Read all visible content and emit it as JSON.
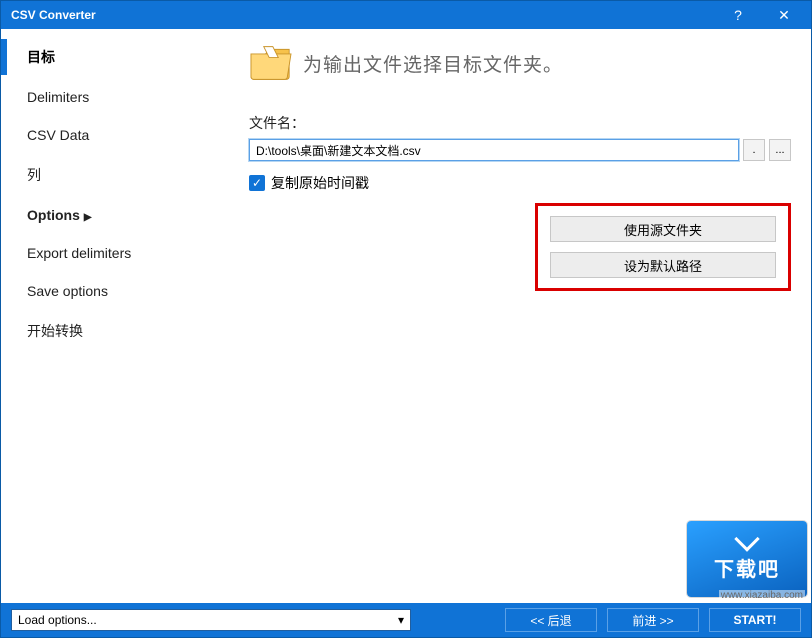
{
  "titlebar": {
    "title": "CSV Converter",
    "help": "?",
    "close": "✕"
  },
  "sidebar": {
    "items": [
      {
        "label": "目标",
        "active": true
      },
      {
        "label": "Delimiters"
      },
      {
        "label": "CSV Data"
      },
      {
        "label": "列"
      },
      {
        "label": "Options",
        "bold": true,
        "arrow": "▶"
      },
      {
        "label": "Export delimiters"
      },
      {
        "label": "Save options"
      },
      {
        "label": "开始转换"
      }
    ]
  },
  "main": {
    "heading": "为输出文件选择目标文件夹。",
    "file_label": "文件名：",
    "file_value": "D:\\tools\\桌面\\新建文本文档.csv",
    "dot_btn": ".",
    "more_btn": "...",
    "checkbox_label": "复制原始时间戳",
    "checkbox_checked": true,
    "side_buttons": {
      "use_source": "使用源文件夹",
      "set_default": "设为默认路径"
    }
  },
  "footer": {
    "load_options": "Load options...",
    "back": "<<  后退",
    "next": "前进  >>",
    "start": "START!"
  },
  "watermark": {
    "text": "下载吧",
    "url": "www.xiazaiba.com"
  }
}
